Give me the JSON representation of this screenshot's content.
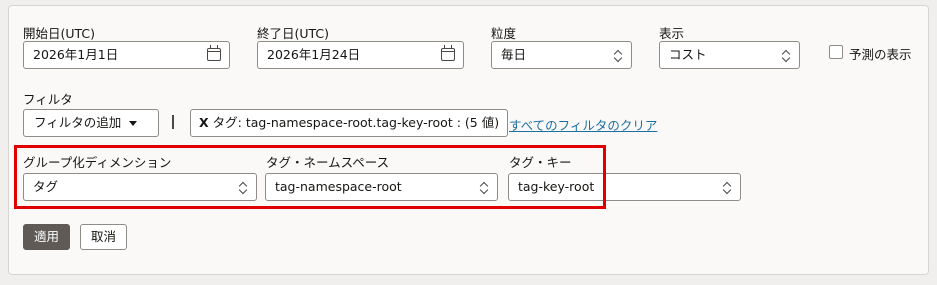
{
  "start_date": {
    "label": "開始日(UTC)",
    "value": "2026年1月1日",
    "icon": "calendar-icon"
  },
  "end_date": {
    "label": "終了日(UTC)",
    "value": "2026年1月24日",
    "icon": "calendar-icon"
  },
  "granularity": {
    "label": "粒度",
    "value": "毎日"
  },
  "display": {
    "label": "表示",
    "value": "コスト"
  },
  "forecast": {
    "label": "予測の表示",
    "checked": false
  },
  "filter": {
    "label": "フィルタ",
    "add_button": "フィルタの追加",
    "chip_remove": "X",
    "chip_text": "タグ: tag-namespace-root.tag-key-root : (5 値)",
    "clear_all": "すべてのフィルタのクリア"
  },
  "group_by": {
    "label": "グループ化ディメンション",
    "value": "タグ"
  },
  "tag_namespace": {
    "label": "タグ・ネームスペース",
    "value": "tag-namespace-root"
  },
  "tag_key": {
    "label": "タグ・キー",
    "value": "tag-key-root"
  },
  "actions": {
    "apply": "適用",
    "cancel": "取消"
  },
  "colors": {
    "highlight": "#e00000",
    "link": "#1a6fa3",
    "apply_bg": "#5f5a56"
  }
}
